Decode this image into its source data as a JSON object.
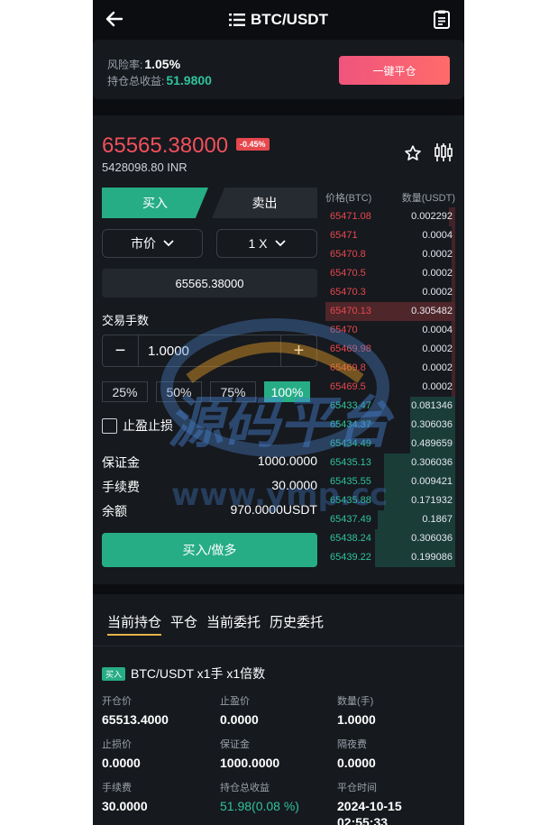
{
  "header": {
    "title": "BTC/USDT"
  },
  "risk": {
    "rate_label": "风险率:",
    "rate_value": "1.05%",
    "pnl_label": "持仓总收益:",
    "pnl_value": "51.9800",
    "close_all_label": "一键平仓"
  },
  "ticker": {
    "price": "65565.38000",
    "change": "-0.45%",
    "inr": "5428098.80 INR"
  },
  "trade": {
    "buy_tab": "买入",
    "sell_tab": "卖出",
    "order_type": "市价",
    "leverage": "1 X",
    "price_input": "65565.38000",
    "qty_label": "交易手数",
    "qty_value": "1.0000",
    "minus": "−",
    "plus": "+",
    "percents": [
      "25%",
      "50%",
      "75%",
      "100%"
    ],
    "tpsl_label": "止盈止损",
    "margin_label": "保证金",
    "margin_value": "1000.0000",
    "fee_label": "手续费",
    "fee_value": "30.0000",
    "balance_label": "余额",
    "balance_value": "970.0000USDT",
    "submit_label": "买入/做多"
  },
  "orderbook": {
    "price_header": "价格(BTC)",
    "qty_header": "数量(USDT)",
    "asks": [
      {
        "p": "65471.08",
        "q": "0.002292",
        "w": 0.05
      },
      {
        "p": "65471",
        "q": "0.0004",
        "w": 0.02
      },
      {
        "p": "65470.8",
        "q": "0.0002",
        "w": 0.02
      },
      {
        "p": "65470.5",
        "q": "0.0002",
        "w": 0.02
      },
      {
        "p": "65470.3",
        "q": "0.0002",
        "w": 0.02
      },
      {
        "p": "65470.13",
        "q": "0.305482",
        "w": 1.0
      },
      {
        "p": "65470",
        "q": "0.0004",
        "w": 0.02
      },
      {
        "p": "65469.98",
        "q": "0.0002",
        "w": 0.02
      },
      {
        "p": "65469.8",
        "q": "0.0002",
        "w": 0.02
      },
      {
        "p": "65469.5",
        "q": "0.0002",
        "w": 0.02
      }
    ],
    "bids": [
      {
        "p": "65433.47",
        "q": "0.081346",
        "w": 0.35
      },
      {
        "p": "65434.37",
        "q": "0.306036",
        "w": 0.35
      },
      {
        "p": "65434.49",
        "q": "0.489659",
        "w": 0.35
      },
      {
        "p": "65435.13",
        "q": "0.306036",
        "w": 0.55
      },
      {
        "p": "65435.55",
        "q": "0.009421",
        "w": 0.55
      },
      {
        "p": "65435.88",
        "q": "0.171932",
        "w": 0.55
      },
      {
        "p": "65437.49",
        "q": "0.1867",
        "w": 0.6
      },
      {
        "p": "65438.24",
        "q": "0.306036",
        "w": 0.62
      },
      {
        "p": "65439.22",
        "q": "0.199086",
        "w": 0.62
      }
    ]
  },
  "positions": {
    "tabs": [
      "当前持仓",
      "平仓",
      "当前委托",
      "历史委托"
    ],
    "badge": "买入",
    "title": "BTC/USDT x1手 x1倍数",
    "open_price_label": "开仓价",
    "open_price": "65513.4000",
    "tp_label": "止盈价",
    "tp": "0.0000",
    "qty_label": "数量(手)",
    "qty": "1.0000",
    "sl_label": "止损价",
    "sl": "0.0000",
    "margin_label": "保证金",
    "margin": "1000.0000",
    "overnight_label": "隔夜费",
    "overnight": "0.0000",
    "fee_label": "手续费",
    "fee": "30.0000",
    "pnl_label": "持仓总收益",
    "pnl": "51.98(0.08 %)",
    "close_time_label": "平仓时间",
    "close_date": "2024-10-15",
    "close_time": "02:55:33"
  },
  "watermark": {
    "main": "源码平台",
    "url": "www.ymp.cc"
  },
  "colors": {
    "green": "#27ad86",
    "red": "#e5484d",
    "bg": "#0b0d10",
    "card": "#16191e"
  }
}
